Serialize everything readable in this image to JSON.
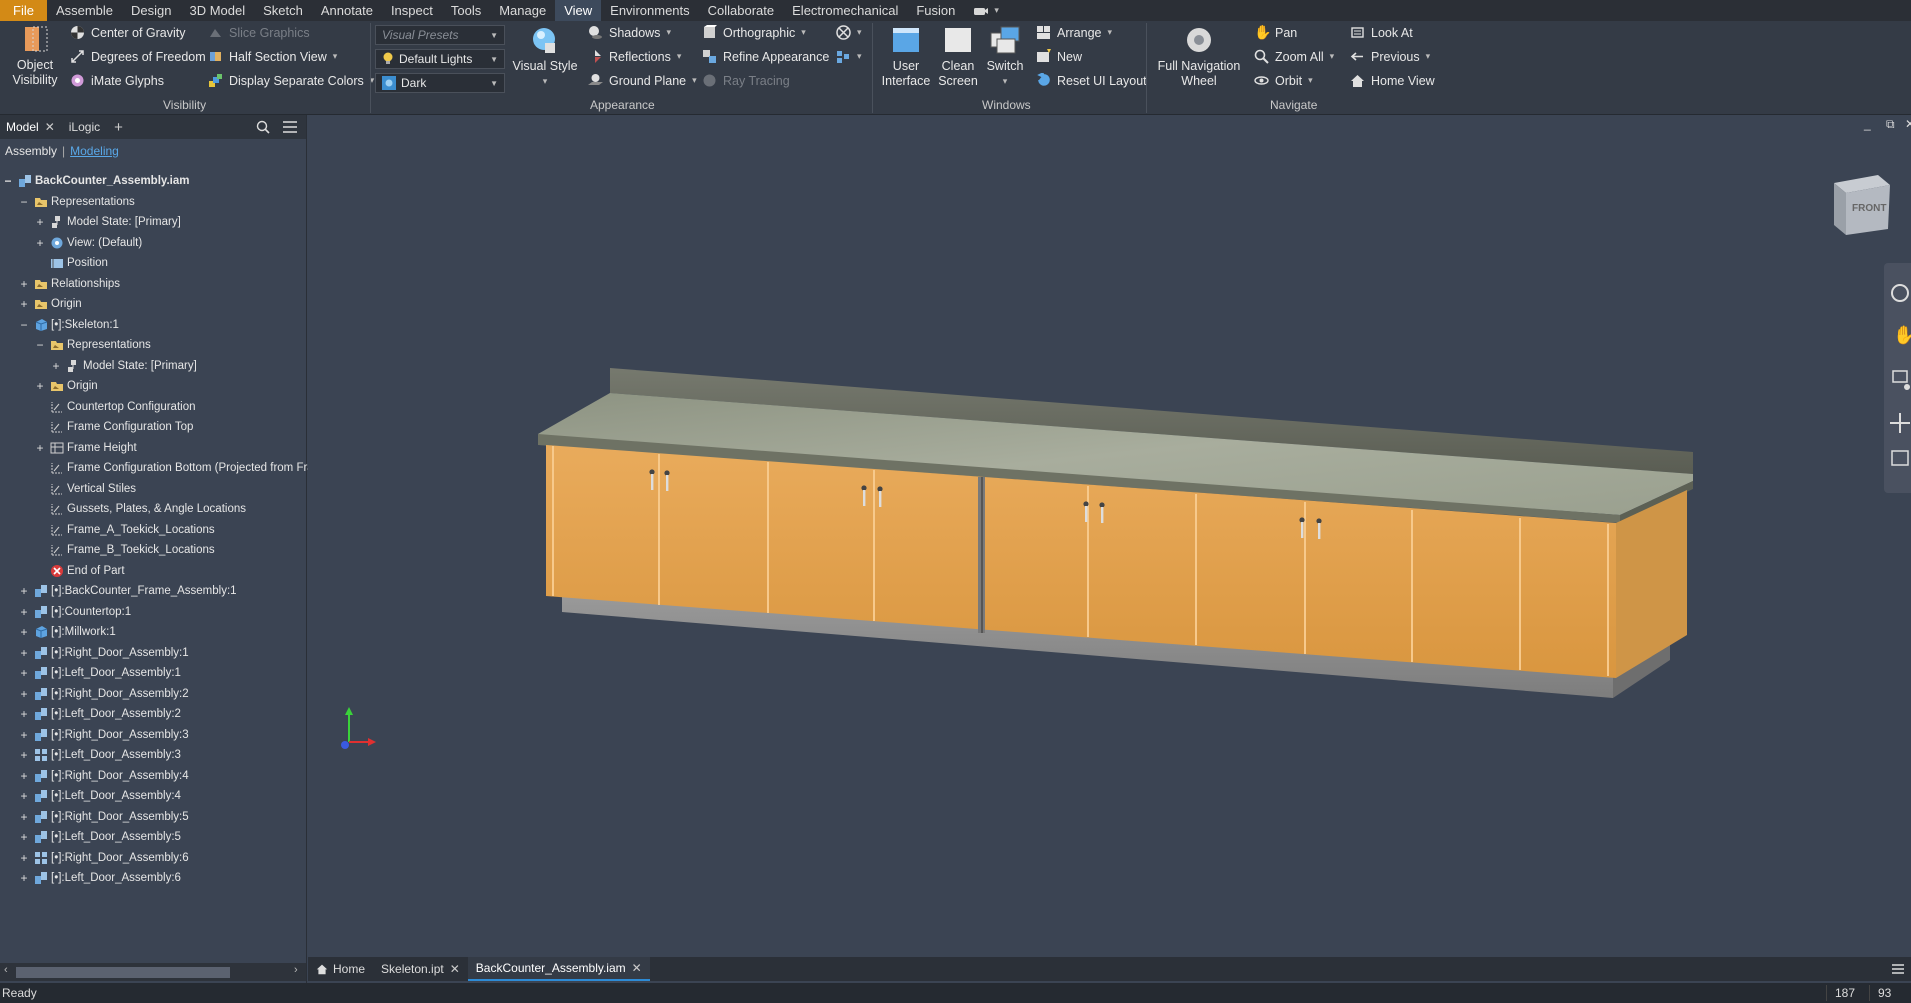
{
  "menu": {
    "tabs": [
      "File",
      "Assemble",
      "Design",
      "3D Model",
      "Sketch",
      "Annotate",
      "Inspect",
      "Tools",
      "Manage",
      "View",
      "Environments",
      "Collaborate",
      "Electromechanical",
      "Fusion"
    ],
    "active_tab": "View"
  },
  "ribbon": {
    "visibility": {
      "object_visibility": "Object Visibility",
      "center_of_gravity": "Center of Gravity",
      "degrees_of_freedom": "Degrees of Freedom",
      "imate_glyphs": "iMate Glyphs",
      "slice_graphics": "Slice Graphics",
      "half_section_view": "Half Section View",
      "display_separate_colors": "Display Separate Colors",
      "panel_label": "Visibility"
    },
    "appearance": {
      "visual_presets": "Visual Presets",
      "lights": "Default Lights",
      "theme": "Dark",
      "visual_style": "Visual Style",
      "shadows": "Shadows",
      "reflections": "Reflections",
      "ground_plane": "Ground Plane",
      "orthographic": "Orthographic",
      "refine_appearance": "Refine Appearance",
      "ray_tracing": "Ray Tracing",
      "panel_label": "Appearance"
    },
    "windows": {
      "user_interface": "User Interface",
      "clean_screen": "Clean Screen",
      "switch": "Switch",
      "arrange": "Arrange",
      "new": "New",
      "reset_ui_layout": "Reset UI Layout",
      "panel_label": "Windows"
    },
    "navigate": {
      "full_navigation_wheel": "Full Navigation Wheel",
      "pan": "Pan",
      "zoom_all": "Zoom All",
      "orbit": "Orbit",
      "look_at": "Look At",
      "previous": "Previous",
      "home_view": "Home View",
      "panel_label": "Navigate"
    }
  },
  "browser": {
    "tabs": [
      "Model",
      "iLogic"
    ],
    "sub_a": "Assembly",
    "sub_b": "Modeling",
    "tree": [
      {
        "label": "BackCounter_Assembly.iam",
        "icon": "assembly-icon"
      },
      {
        "label": "Representations",
        "icon": "folder-icon"
      },
      {
        "label": "Model State: [Primary]",
        "icon": "model-state-icon"
      },
      {
        "label": "View: (Default)",
        "icon": "view-rep-icon"
      },
      {
        "label": "Position",
        "icon": "position-icon"
      },
      {
        "label": "Relationships",
        "icon": "folder-icon"
      },
      {
        "label": "Origin",
        "icon": "folder-icon"
      },
      {
        "label": "[•]:Skeleton:1",
        "icon": "part-icon"
      },
      {
        "label": "Representations",
        "icon": "folder-icon"
      },
      {
        "label": "Model State: [Primary]",
        "icon": "model-state-icon"
      },
      {
        "label": "Origin",
        "icon": "folder-icon"
      },
      {
        "label": "Countertop Configuration",
        "icon": "sketch-icon"
      },
      {
        "label": "Frame Configuration Top",
        "icon": "sketch-icon"
      },
      {
        "label": "Frame Height",
        "icon": "feature-icon"
      },
      {
        "label": "Frame Configuration Bottom (Projected from Frame C",
        "icon": "sketch-icon"
      },
      {
        "label": "Vertical Stiles",
        "icon": "sketch-icon"
      },
      {
        "label": "Gussets, Plates, & Angle Locations",
        "icon": "sketch-icon"
      },
      {
        "label": "Frame_A_Toekick_Locations",
        "icon": "sketch-icon"
      },
      {
        "label": "Frame_B_Toekick_Locations",
        "icon": "sketch-icon"
      },
      {
        "label": "End of Part",
        "icon": "end-of-part-icon"
      },
      {
        "label": "[•]:BackCounter_Frame_Assembly:1",
        "icon": "assembly-icon"
      },
      {
        "label": "[•]:Countertop:1",
        "icon": "assembly-icon"
      },
      {
        "label": "[•]:Millwork:1",
        "icon": "part-icon"
      },
      {
        "label": "[•]:Right_Door_Assembly:1",
        "icon": "assembly-icon"
      },
      {
        "label": "[•]:Left_Door_Assembly:1",
        "icon": "assembly-icon"
      },
      {
        "label": "[•]:Right_Door_Assembly:2",
        "icon": "assembly-icon"
      },
      {
        "label": "[•]:Left_Door_Assembly:2",
        "icon": "assembly-icon"
      },
      {
        "label": "[•]:Right_Door_Assembly:3",
        "icon": "assembly-icon"
      },
      {
        "label": "[•]:Left_Door_Assembly:3",
        "icon": "pattern-assembly-icon"
      },
      {
        "label": "[•]:Right_Door_Assembly:4",
        "icon": "assembly-icon"
      },
      {
        "label": "[•]:Left_Door_Assembly:4",
        "icon": "assembly-icon"
      },
      {
        "label": "[•]:Right_Door_Assembly:5",
        "icon": "assembly-icon"
      },
      {
        "label": "[•]:Left_Door_Assembly:5",
        "icon": "assembly-icon"
      },
      {
        "label": "[•]:Right_Door_Assembly:6",
        "icon": "pattern-assembly-icon"
      },
      {
        "label": "[•]:Left_Door_Assembly:6",
        "icon": "assembly-icon"
      }
    ]
  },
  "viewport": {
    "viewcube_face": "FRONT"
  },
  "doc_tabs": {
    "home": "Home",
    "tabs": [
      "Skeleton.ipt",
      "BackCounter_Assembly.iam"
    ],
    "active": "BackCounter_Assembly.iam"
  },
  "status": {
    "text": "Ready",
    "num1": "187",
    "num2": "93"
  },
  "colors": {
    "accent": "#d38a16",
    "selection": "#2d8bd6",
    "background": "#3b4453"
  }
}
